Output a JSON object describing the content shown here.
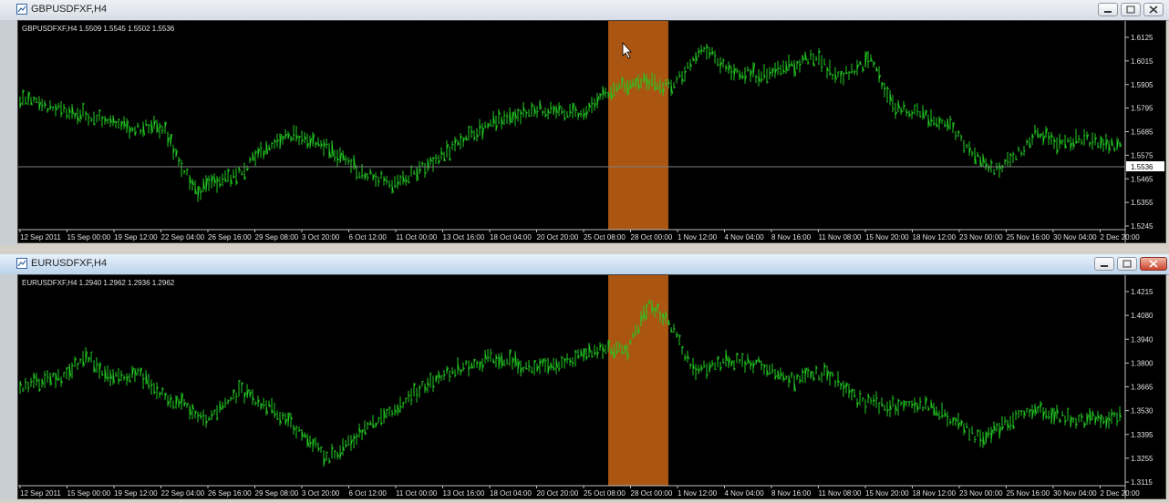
{
  "windows": [
    {
      "title": "GBPUSDFXF,H4",
      "info": "GBPUSDFXF,H4  1.5509 1.5545 1.5502 1.5536",
      "current_price": "1.5536",
      "price_labels": [
        "1.6125",
        "1.6015",
        "1.5905",
        "1.5795",
        "1.5685",
        "1.5575",
        "1.5465",
        "1.5355",
        "1.5245"
      ],
      "time_labels": [
        "12 Sep 2011",
        "15 Sep 00:00",
        "19 Sep 12:00",
        "22 Sep 04:00",
        "26 Sep 16:00",
        "29 Sep 08:00",
        "3 Oct 20:00",
        "6 Oct 12:00",
        "11 Oct 00:00",
        "13 Oct 16:00",
        "18 Oct 04:00",
        "20 Oct 20:00",
        "25 Oct 08:00",
        "28 Oct 00:00",
        "1 Nov 12:00",
        "4 Nov 04:00",
        "8 Nov 16:00",
        "11 Nov 08:00",
        "15 Nov 20:00",
        "18 Nov 12:00",
        "23 Nov 00:00",
        "25 Nov 16:00",
        "30 Nov 04:00",
        "2 Dec 20:00"
      ]
    },
    {
      "title": "EURUSDFXF,H4",
      "info": "EURUSDFXF,H4  1.2940 1.2962 1.2936 1.2962",
      "price_labels": [
        "1.4215",
        "1.4080",
        "1.3940",
        "1.3800",
        "1.3665",
        "1.3530",
        "1.3395",
        "1.3255",
        "1.3115"
      ],
      "time_labels": [
        "12 Sep 2011",
        "15 Sep 00:00",
        "19 Sep 12:00",
        "22 Sep 04:00",
        "26 Sep 16:00",
        "29 Sep 08:00",
        "3 Oct 20:00",
        "6 Oct 12:00",
        "11 Oct 00:00",
        "13 Oct 16:00",
        "18 Oct 04:00",
        "20 Oct 20:00",
        "25 Oct 08:00",
        "28 Oct 00:00",
        "1 Nov 12:00",
        "4 Nov 04:00",
        "8 Nov 16:00",
        "11 Nov 08:00",
        "15 Nov 20:00",
        "18 Nov 12:00",
        "23 Nov 00:00",
        "25 Nov 16:00",
        "30 Nov 04:00",
        "2 Dec 20:00"
      ]
    }
  ],
  "colors": {
    "bars": "#22cc22",
    "highlight": "#c86414",
    "background": "#000000",
    "axis": "#c0c0c0",
    "grid_line": "#808080"
  },
  "icons": {
    "window_icon": "chart-window-icon",
    "minimize": "minimize-icon",
    "maximize": "maximize-icon",
    "close": "close-icon",
    "cursor": "mouse-pointer-icon"
  }
}
